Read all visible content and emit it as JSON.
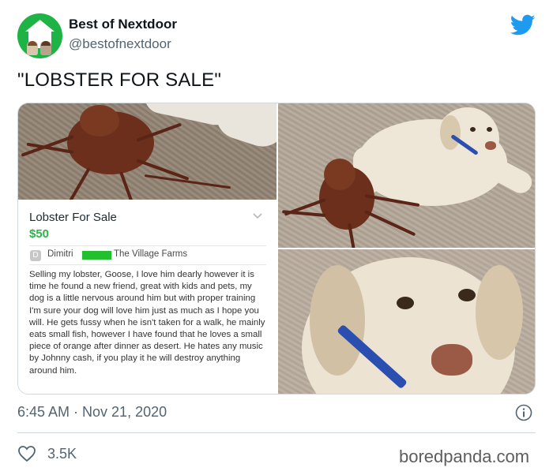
{
  "author": {
    "display_name": "Best of Nextdoor",
    "handle": "@bestofnextdoor"
  },
  "tweet": {
    "text": "\"LOBSTER FOR SALE\"",
    "timestamp": "6:45 AM · Nov 21, 2020",
    "likes": "3.5K"
  },
  "listing": {
    "title": "Lobster For Sale",
    "price": "$50",
    "seller_initial": "D",
    "seller_name": "Dimitri",
    "location": "The Village Farms",
    "description": "Selling my lobster, Goose, I love him dearly however it is time he found a new friend, great with kids and pets, my dog is a little nervous around him but with proper training I'm sure your dog will love him just as much as I hope you will. He gets fussy when he isn't taken for a walk, he mainly eats small fish, however I have found that he loves a small piece of orange after dinner as desert. He hates any music by Johnny cash, if you play it he will destroy anything around him."
  },
  "watermark": "boredpanda.com",
  "icons": {
    "brand": "twitter-bird-icon",
    "info": "info-icon",
    "like": "heart-icon",
    "listing_toggle": "chevron-down-icon"
  },
  "colors": {
    "twitter_blue": "#1d9bf0",
    "nextdoor_green": "#1db345",
    "price_green": "#2db34a",
    "redaction_green": "#22c02e",
    "secondary_text": "#536471"
  }
}
